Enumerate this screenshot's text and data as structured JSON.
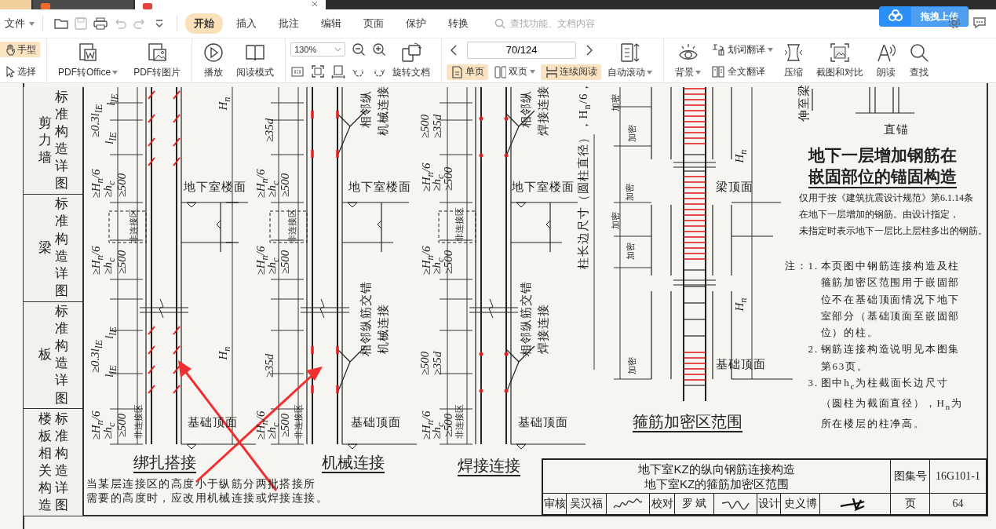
{
  "window_tabs": [
    {
      "kind": "home",
      "selected": false
    },
    {
      "kind": "app",
      "selected": false
    },
    {
      "kind": "document",
      "selected": true
    }
  ],
  "menu": {
    "file": "文件",
    "tabs": [
      {
        "label": "开始",
        "selected": true
      },
      {
        "label": "插入",
        "selected": false
      },
      {
        "label": "批注",
        "selected": false
      },
      {
        "label": "编辑",
        "selected": false
      },
      {
        "label": "页面",
        "selected": false
      },
      {
        "label": "保护",
        "selected": false
      },
      {
        "label": "转换",
        "selected": false
      }
    ],
    "search": {
      "placeholder": "查找功能、文档内容"
    },
    "upload": "拖拽上传"
  },
  "toolbar": {
    "tools": [
      {
        "label": "手型",
        "selected": true
      },
      {
        "label": "选择",
        "selected": false
      }
    ],
    "convert": [
      {
        "label": "PDF转Office",
        "dropdown": true
      },
      {
        "label": "PDF转图片",
        "dropdown": false
      }
    ],
    "play": "播放",
    "read_mode": "阅读模式",
    "zoom": "130%",
    "rotate": "旋转文档",
    "page": "70/124",
    "view_modes": [
      {
        "label": "单页",
        "selected": true,
        "dropdown": false
      },
      {
        "label": "双页",
        "selected": false,
        "dropdown": true
      },
      {
        "label": "连续阅读",
        "selected": true,
        "dropdown": false
      }
    ],
    "auto_scroll": "自动滚动",
    "background": "背景",
    "word_translate": "划词翻译",
    "full_translate": "全文翻译",
    "compress": "压缩",
    "screenshot": "截图和对比",
    "read_aloud": "朗读",
    "find": "查找"
  },
  "document": {
    "side_sections": [
      {
        "name": "剪力墙",
        "label": "标准构造详图"
      },
      {
        "name": "梁",
        "label": "标准构造详图"
      },
      {
        "name": "板",
        "label": "标准构造详图"
      },
      {
        "name": "楼板相关构造",
        "label": "标准构造详图"
      }
    ],
    "labels": [
      {
        "kind": "dim",
        "text": "≥0.3l$_{lE}$"
      },
      {
        "kind": "dim",
        "text": "l$_{lE}$"
      },
      {
        "kind": "dim",
        "text": "l$_{lE}$"
      },
      {
        "kind": "dim",
        "text": "≥H$_{n}$/6"
      },
      {
        "kind": "dim",
        "text": "≥h$_{c}$"
      },
      {
        "kind": "dim",
        "text": "≥500"
      },
      {
        "kind": "zone",
        "text": "非连接区"
      },
      {
        "kind": "dim",
        "text": "≥H$_{n}$/6"
      },
      {
        "kind": "dim",
        "text": "≥h$_{c}$"
      },
      {
        "kind": "dim",
        "text": "≥500"
      },
      {
        "kind": "dim",
        "text": "≥0.3l$_{lE}$"
      },
      {
        "kind": "dim",
        "text": "l$_{lE}$"
      },
      {
        "kind": "dim",
        "text": "l$_{lE}$"
      },
      {
        "kind": "dim",
        "text": "≥H$_{n}$/6"
      },
      {
        "kind": "dim",
        "text": "≥h$_{c}$"
      },
      {
        "kind": "dim",
        "text": "≥500"
      },
      {
        "kind": "zone",
        "text": "非连接区"
      },
      {
        "kind": "dim",
        "text": "H$_{n}$"
      },
      {
        "kind": "dim",
        "text": "H$_{n}$"
      },
      {
        "kind": "text",
        "text": "地下室楼面"
      },
      {
        "kind": "text",
        "text": "基础顶面"
      },
      {
        "kind": "title",
        "text": "绑扎搭接"
      },
      {
        "kind": "dim",
        "text": "≥35d"
      },
      {
        "kind": "dim",
        "text": "≥H$_{n}$/6"
      },
      {
        "kind": "dim",
        "text": "≥h$_{c}$"
      },
      {
        "kind": "dim",
        "text": "≥500"
      },
      {
        "kind": "zone",
        "text": "非连接区"
      },
      {
        "kind": "dim",
        "text": "≥H$_{n}$/6"
      },
      {
        "kind": "dim",
        "text": "≥h$_{c}$"
      },
      {
        "kind": "dim",
        "text": "≥500"
      },
      {
        "kind": "dim",
        "text": "≥35d"
      },
      {
        "kind": "dim",
        "text": "≥H$_{n}$/6"
      },
      {
        "kind": "dim",
        "text": "≥h$_{c}$"
      },
      {
        "kind": "dim",
        "text": "≥500"
      },
      {
        "kind": "zone",
        "text": "非连接区"
      },
      {
        "kind": "rotated",
        "text": "相邻纵"
      },
      {
        "kind": "rotated",
        "text": "机械连接"
      },
      {
        "kind": "rotated",
        "text": "相邻纵筋交错"
      },
      {
        "kind": "rotated",
        "text": "机械连接"
      },
      {
        "kind": "text",
        "text": "地下室楼面"
      },
      {
        "kind": "text",
        "text": "基础顶面"
      },
      {
        "kind": "title",
        "text": "机械连接"
      },
      {
        "kind": "dim",
        "text": "≥500"
      },
      {
        "kind": "dim",
        "text": "≥35d"
      },
      {
        "kind": "dim",
        "text": "≥H$_{n}$/6"
      },
      {
        "kind": "dim",
        "text": "≥h$_{c}$"
      },
      {
        "kind": "dim",
        "text": "≥500"
      },
      {
        "kind": "zone",
        "text": "非连接区"
      },
      {
        "kind": "dim",
        "text": "≥H$_{n}$/6"
      },
      {
        "kind": "dim",
        "text": "≥h$_{c}$"
      },
      {
        "kind": "dim",
        "text": "≥500"
      },
      {
        "kind": "dim",
        "text": "≥500"
      },
      {
        "kind": "dim",
        "text": "≥35d"
      },
      {
        "kind": "dim",
        "text": "≥H$_{n}$/6"
      },
      {
        "kind": "dim",
        "text": "≥h$_{c}$"
      },
      {
        "kind": "dim",
        "text": "≥500"
      },
      {
        "kind": "zone",
        "text": "非连接区"
      },
      {
        "kind": "rotated",
        "text": "相邻纵"
      },
      {
        "kind": "rotated",
        "text": "焊接连接"
      },
      {
        "kind": "rotated",
        "text": "相邻纵筋交错"
      },
      {
        "kind": "rotated",
        "text": "焊接连接"
      },
      {
        "kind": "text",
        "text": "地下室楼面"
      },
      {
        "kind": "text",
        "text": "基础顶面"
      },
      {
        "kind": "title",
        "text": "焊接连接"
      },
      {
        "kind": "rotated",
        "text": "柱长边尺寸（圆柱直径），H$_{n}$/6，"
      },
      {
        "kind": "zone",
        "text": "加密"
      },
      {
        "kind": "zone",
        "text": "加密"
      },
      {
        "kind": "zone",
        "text": "加密"
      },
      {
        "kind": "zone",
        "text": "加密"
      },
      {
        "kind": "zone",
        "text": "加密"
      },
      {
        "kind": "zone",
        "text": "加密"
      },
      {
        "kind": "dim",
        "text": "H$_{n}$"
      },
      {
        "kind": "dim",
        "text": "H$_{n}$"
      },
      {
        "kind": "text",
        "text": "梁顶面"
      },
      {
        "kind": "text",
        "text": "基础顶面"
      },
      {
        "kind": "title",
        "text": "箍筋加密区范围"
      },
      {
        "kind": "rotated",
        "text": "伸至梁"
      },
      {
        "kind": "text",
        "text": "直锚"
      }
    ],
    "footnote_lines": [
      "当某层连接区的高度小于纵筋分两批搭接所",
      "需要的高度时，应改用机械连接或焊接连接。"
    ],
    "anchor_title": [
      "地下一层增加钢筋在",
      "嵌固部位的锚固构造"
    ],
    "anchor_description": [
      "仅用于按《建筑抗震设计规范》第6.1.14条",
      "在地下一层增加的钢筋。由设计指定，",
      "未指定时表示地下一层比上层柱多出的钢筋。"
    ],
    "notes": {
      "heading": "注：",
      "items": [
        {
          "number": "1.",
          "text": "本页图中钢筋连接构造及柱箍筋加密区范围用于嵌固部位不在基础顶面情况下地下室部分（基础顶面至嵌固部位）的柱。"
        },
        {
          "number": "2.",
          "text": "钢筋连接构造说明见本图集第63页。"
        },
        {
          "number": "3.",
          "text": "图中h$_{c}$为柱截面长边尺寸（圆柱为截面直径），H$_{n}$为所在楼层的柱净高。"
        }
      ]
    },
    "title_block": {
      "titles": [
        "地下室KZ的纵向钢筋连接构造",
        "地下室KZ的箍筋加密区范围"
      ],
      "atlas_label": "图集号",
      "atlas_no": "16G101-1",
      "roles": [
        {
          "role": "审核",
          "name": "吴汉福"
        },
        {
          "role": "校对",
          "name": "罗  斌"
        },
        {
          "role": "设计",
          "name": "史义博"
        }
      ],
      "page_label": "页",
      "page": "64"
    }
  }
}
